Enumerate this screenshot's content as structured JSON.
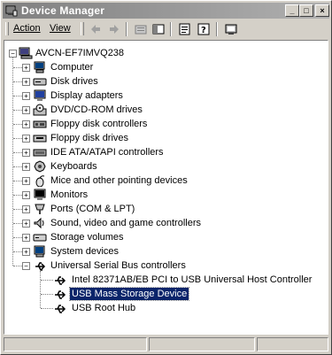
{
  "window": {
    "title": "Device Manager",
    "buttons": {
      "minimize": "_",
      "maximize": "□",
      "close": "×"
    }
  },
  "menu": {
    "action": "Action",
    "view": "View"
  },
  "toolbar": {
    "icons": [
      "back-icon",
      "forward-icon",
      "up-folder-icon",
      "show-hide-tree-icon",
      "properties-icon",
      "help-icon",
      "scan-hardware-icon"
    ]
  },
  "tree": {
    "root": "AVCN-EF7IMVQ238",
    "categories": [
      {
        "label": "Computer",
        "icon": "computer-icon"
      },
      {
        "label": "Disk drives",
        "icon": "disk-drive-icon"
      },
      {
        "label": "Display adapters",
        "icon": "display-adapter-icon"
      },
      {
        "label": "DVD/CD-ROM drives",
        "icon": "cdrom-icon"
      },
      {
        "label": "Floppy disk controllers",
        "icon": "controller-icon"
      },
      {
        "label": "Floppy disk drives",
        "icon": "floppy-icon"
      },
      {
        "label": "IDE ATA/ATAPI controllers",
        "icon": "ide-icon"
      },
      {
        "label": "Keyboards",
        "icon": "keyboard-icon"
      },
      {
        "label": "Mice and other pointing devices",
        "icon": "mouse-icon"
      },
      {
        "label": "Monitors",
        "icon": "monitor-icon"
      },
      {
        "label": "Ports (COM & LPT)",
        "icon": "port-icon"
      },
      {
        "label": "Sound, video and game controllers",
        "icon": "sound-icon"
      },
      {
        "label": "Storage volumes",
        "icon": "storage-icon"
      },
      {
        "label": "System devices",
        "icon": "system-icon"
      },
      {
        "label": "Universal Serial Bus controllers",
        "icon": "usb-icon"
      }
    ],
    "usb_children": [
      {
        "label": "Intel 82371AB/EB PCI to USB Universal Host Controller",
        "selected": false
      },
      {
        "label": "USB Mass Storage Device",
        "selected": true
      },
      {
        "label": "USB Root Hub",
        "selected": false
      }
    ],
    "expander_collapsed": "+",
    "expander_expanded": "−"
  },
  "colors": {
    "selection": "#0a246a",
    "titlebar_inactive_start": "#808080",
    "face": "#d4d0c8"
  }
}
